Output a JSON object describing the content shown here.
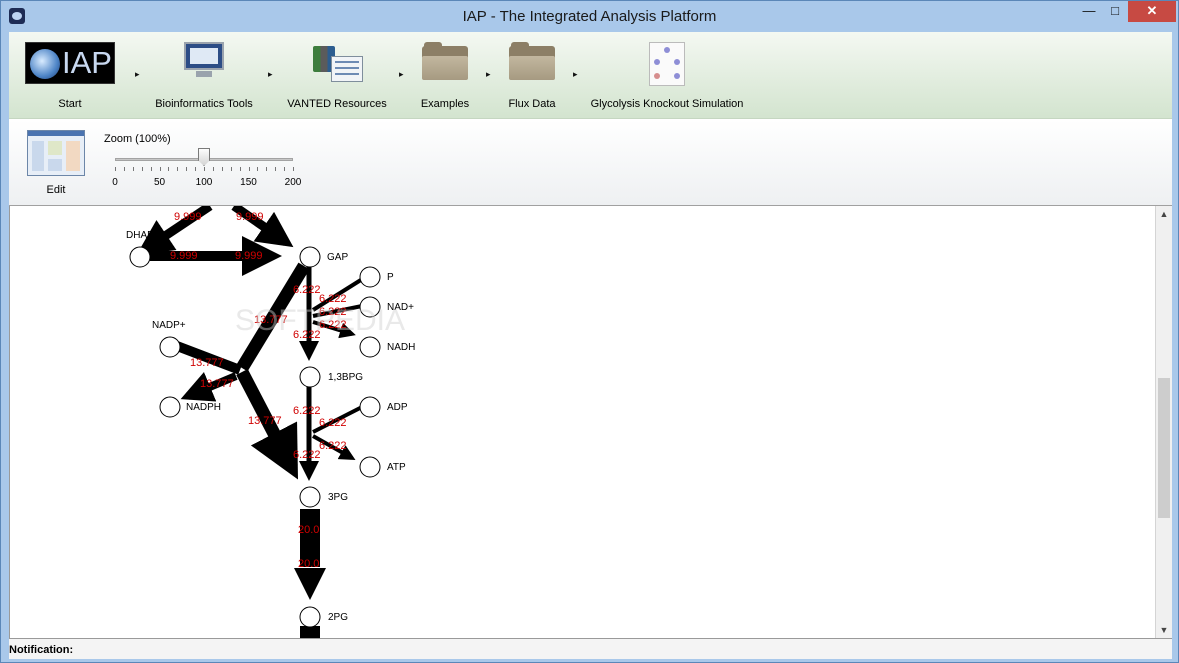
{
  "window": {
    "title": "IAP - The Integrated Analysis Platform",
    "minimize_glyph": "—",
    "maximize_glyph": "□",
    "close_glyph": "✕"
  },
  "nav": {
    "items": [
      {
        "label": "Start"
      },
      {
        "label": "Bioinformatics Tools"
      },
      {
        "label": "VANTED Resources"
      },
      {
        "label": "Examples"
      },
      {
        "label": "Flux Data"
      },
      {
        "label": "Glycolysis Knockout Simulation"
      }
    ],
    "logo_text": "IAP",
    "separator": "▸"
  },
  "toolbar": {
    "edit_label": "Edit",
    "zoom_label": "Zoom (100%)",
    "zoom_percent": 100,
    "zoom_ticks": [
      "0",
      "50",
      "100",
      "150",
      "200"
    ]
  },
  "graph": {
    "nodes": [
      {
        "id": "DHAP",
        "label": "DHAP"
      },
      {
        "id": "GAP",
        "label": "GAP"
      },
      {
        "id": "P",
        "label": "P"
      },
      {
        "id": "NADplus",
        "label": "NAD+"
      },
      {
        "id": "NADH",
        "label": "NADH"
      },
      {
        "id": "NADPplus",
        "label": "NADP+"
      },
      {
        "id": "NADPH",
        "label": "NADPH"
      },
      {
        "id": "BPG",
        "label": "1,3BPG"
      },
      {
        "id": "ADP",
        "label": "ADP"
      },
      {
        "id": "ATP",
        "label": "ATP"
      },
      {
        "id": "PG3",
        "label": "3PG"
      },
      {
        "id": "PG2",
        "label": "2PG"
      }
    ],
    "edge_labels": {
      "top_left": "9.999",
      "top_right": "9.999",
      "dhap_gap_1": "9.999",
      "dhap_gap_2": "9.999",
      "gap_bpg_1": "6.222",
      "p_in": "6.222",
      "nad_in": "6.222",
      "nadh_out": "6.222",
      "gap_bpg_2": "6.222",
      "gap_branch": "13.777",
      "nadp_in": "13.777",
      "nadph_out": "13.777",
      "branch_3pg": "13.777",
      "bpg_3pg_1": "6.222",
      "adp_in": "6.222",
      "atp_out": "6.222",
      "bpg_3pg_2": "6.222",
      "pg3_pg2_1": "20.0",
      "pg3_pg2_2": "20.0"
    },
    "watermark": "SOFTPEDIA"
  },
  "status": {
    "notification_label": "Notification:"
  }
}
